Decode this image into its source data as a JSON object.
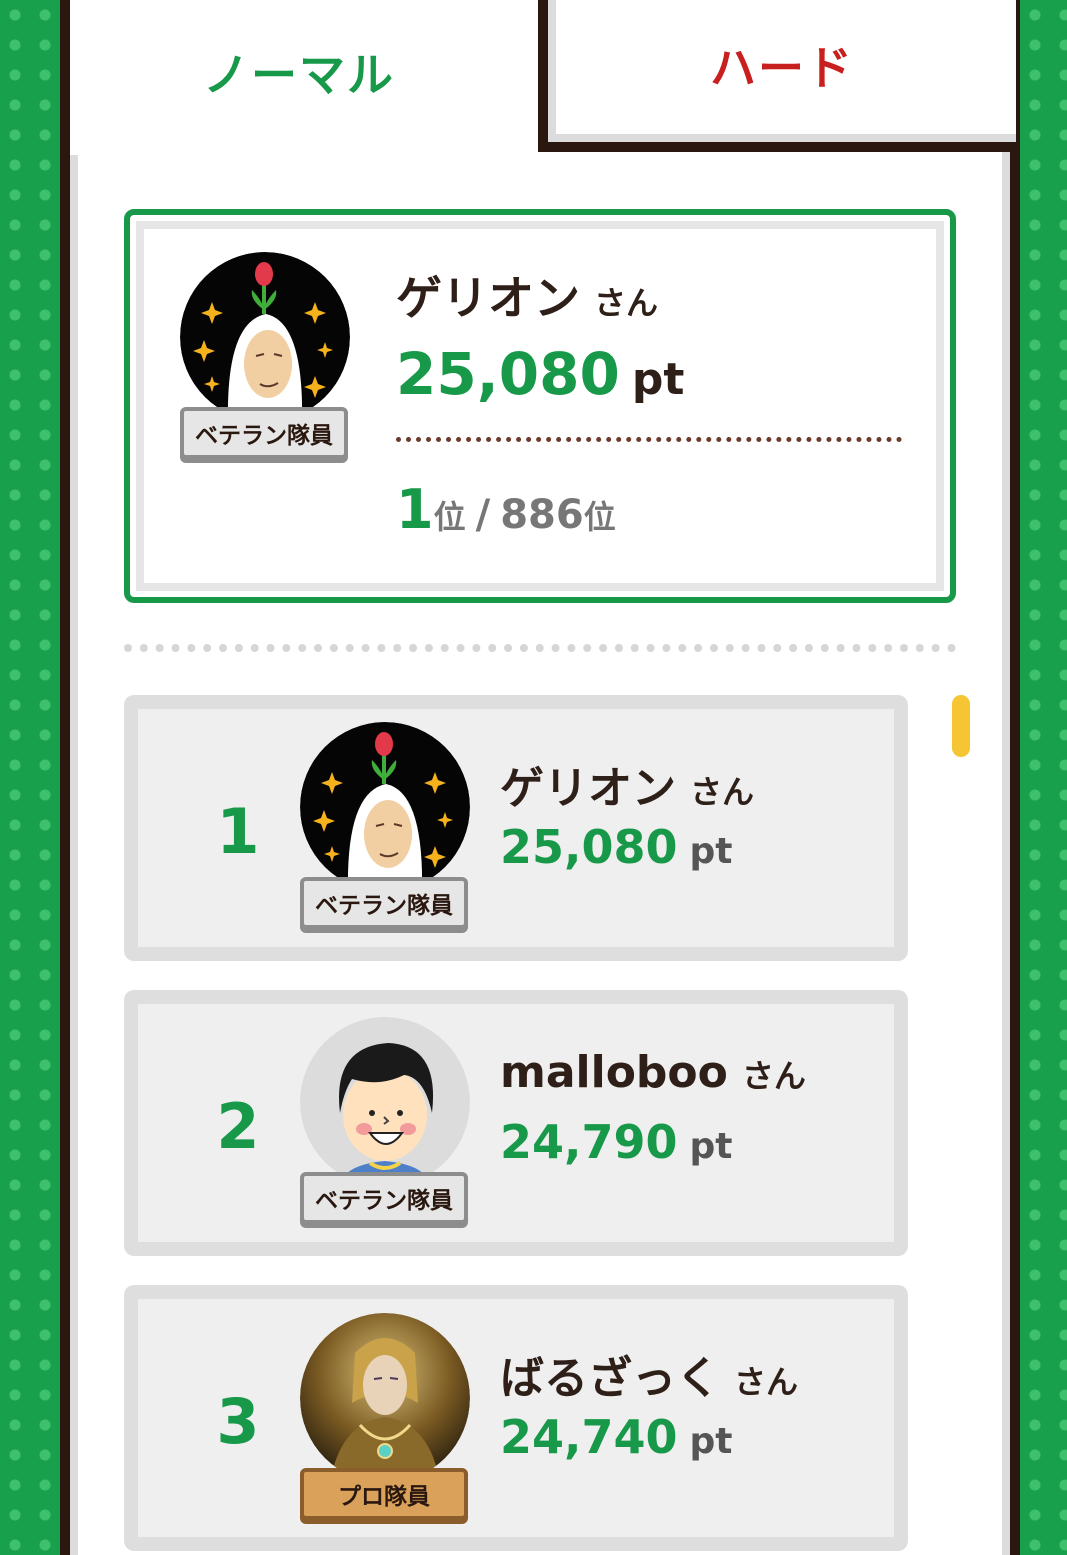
{
  "tabs": [
    {
      "label": "ノーマル",
      "active": true
    },
    {
      "label": "ハード",
      "active": false
    }
  ],
  "my_rank": {
    "name": "ゲリオン",
    "honorific": "さん",
    "points": "25,080",
    "unit": "pt",
    "badge": "ベテラン隊員",
    "rank": "1",
    "rank_suffix": "位",
    "separator": "/",
    "total": "886",
    "total_suffix": "位"
  },
  "ranking": [
    {
      "rank": "1",
      "name": "ゲリオン",
      "honorific": "さん",
      "points": "25,080",
      "unit": "pt",
      "badge": "ベテラン隊員"
    },
    {
      "rank": "2",
      "name": "malloboo",
      "honorific": "さん",
      "points": "24,790",
      "unit": "pt",
      "badge": "ベテラン隊員"
    },
    {
      "rank": "3",
      "name": "ばるざっく",
      "honorific": "さん",
      "points": "24,740",
      "unit": "pt",
      "badge": "プロ隊員"
    }
  ],
  "colors": {
    "accent": "#18994a",
    "hard": "#c8201e",
    "frame": "#2a1810",
    "scroll": "#f5c534"
  }
}
